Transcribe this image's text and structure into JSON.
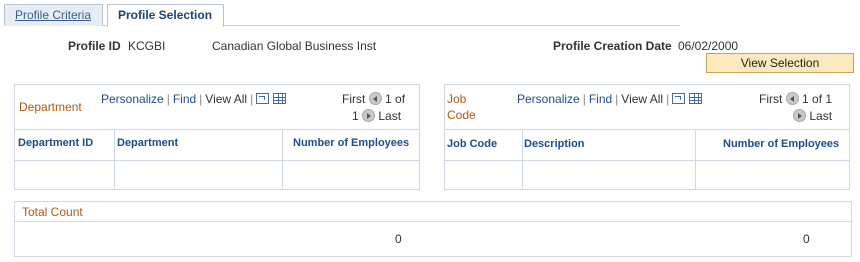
{
  "tabs": [
    {
      "label": "Profile Criteria",
      "active": false
    },
    {
      "label": "Profile Selection",
      "active": true
    }
  ],
  "profile": {
    "id_label": "Profile ID",
    "id_value": "KCGBI",
    "description": "Canadian Global Business Inst",
    "creation_date_label": "Profile Creation Date",
    "creation_date_value": "06/02/2000"
  },
  "view_selection_button": "View Selection",
  "department_grid": {
    "title": "Department",
    "personalize": "Personalize",
    "find": "Find",
    "view_all": "View All",
    "first": "First",
    "range": "1 of",
    "range_total": "1",
    "last": "Last",
    "columns": [
      "Department ID",
      "Department",
      "Number of Employees"
    ],
    "rows": []
  },
  "jobcode_grid": {
    "title_line1": "Job",
    "title_line2": "Code",
    "personalize": "Personalize",
    "find": "Find",
    "view_all": "View All",
    "first": "First",
    "range": "1 of 1",
    "last": "Last",
    "columns": [
      "Job Code",
      "Description",
      "Number of Employees"
    ],
    "rows": []
  },
  "total_count": {
    "title": "Total Count",
    "department_total": "0",
    "jobcode_total": "0"
  },
  "colors": {
    "grid_title": "#b05a12",
    "link": "#1d4d8c",
    "button_bg": "#fce9c0"
  }
}
